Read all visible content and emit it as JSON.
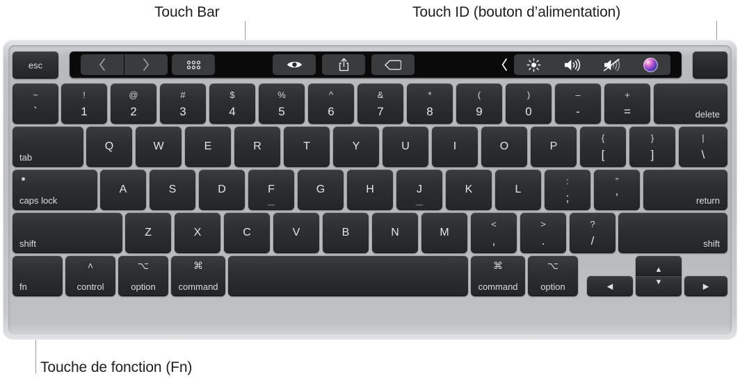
{
  "callouts": [
    {
      "label": "Touch Bar",
      "name": "callout-touch-bar"
    },
    {
      "label": "Touch ID (bouton d’alimentation)",
      "name": "callout-touch-id"
    },
    {
      "label": "Touche de fonction (Fn)",
      "name": "callout-fn"
    }
  ],
  "touchbar": {
    "esc_label": "esc",
    "controls": [
      {
        "name": "back-icon",
        "glyph": "‹"
      },
      {
        "name": "forward-icon",
        "glyph": "›"
      },
      {
        "name": "app-grid-icon",
        "glyph": "grid"
      },
      {
        "name": "preview-eye-icon",
        "glyph": "eye"
      },
      {
        "name": "share-icon",
        "glyph": "share"
      },
      {
        "name": "tag-icon",
        "glyph": "tag"
      },
      {
        "name": "expand-chevron-icon",
        "glyph": "‹"
      },
      {
        "name": "brightness-icon",
        "glyph": "brightness"
      },
      {
        "name": "volume-up-icon",
        "glyph": "volume"
      },
      {
        "name": "mute-icon",
        "glyph": "mute"
      },
      {
        "name": "siri-icon",
        "glyph": "siri"
      }
    ]
  },
  "rows": {
    "number_row": [
      {
        "name": "key-grave",
        "type": "dual",
        "up": "~",
        "down": "`"
      },
      {
        "name": "key-1",
        "type": "dual",
        "up": "!",
        "down": "1"
      },
      {
        "name": "key-2",
        "type": "dual",
        "up": "@",
        "down": "2"
      },
      {
        "name": "key-3",
        "type": "dual",
        "up": "#",
        "down": "3"
      },
      {
        "name": "key-4",
        "type": "dual",
        "up": "$",
        "down": "4"
      },
      {
        "name": "key-5",
        "type": "dual",
        "up": "%",
        "down": "5"
      },
      {
        "name": "key-6",
        "type": "dual",
        "up": "^",
        "down": "6"
      },
      {
        "name": "key-7",
        "type": "dual",
        "up": "&",
        "down": "7"
      },
      {
        "name": "key-8",
        "type": "dual",
        "up": "*",
        "down": "8"
      },
      {
        "name": "key-9",
        "type": "dual",
        "up": "(",
        "down": "9"
      },
      {
        "name": "key-0",
        "type": "dual",
        "up": ")",
        "down": "0"
      },
      {
        "name": "key-minus",
        "type": "dual",
        "up": "–",
        "down": "-"
      },
      {
        "name": "key-equal",
        "type": "dual",
        "up": "+",
        "down": "="
      },
      {
        "name": "key-delete",
        "type": "br",
        "label": "delete"
      }
    ],
    "qwerty_row": [
      {
        "name": "key-tab",
        "type": "bl",
        "label": "tab"
      },
      {
        "name": "key-q",
        "type": "center",
        "label": "Q"
      },
      {
        "name": "key-w",
        "type": "center",
        "label": "W"
      },
      {
        "name": "key-e",
        "type": "center",
        "label": "E"
      },
      {
        "name": "key-r",
        "type": "center",
        "label": "R"
      },
      {
        "name": "key-t",
        "type": "center",
        "label": "T"
      },
      {
        "name": "key-y",
        "type": "center",
        "label": "Y"
      },
      {
        "name": "key-u",
        "type": "center",
        "label": "U"
      },
      {
        "name": "key-i",
        "type": "center",
        "label": "I"
      },
      {
        "name": "key-o",
        "type": "center",
        "label": "O"
      },
      {
        "name": "key-p",
        "type": "center",
        "label": "P"
      },
      {
        "name": "key-bracket-left",
        "type": "dual",
        "up": "{",
        "down": "["
      },
      {
        "name": "key-bracket-right",
        "type": "dual",
        "up": "}",
        "down": "]"
      },
      {
        "name": "key-backslash",
        "type": "dual",
        "up": "|",
        "down": "\\"
      }
    ],
    "home_row": [
      {
        "name": "key-caps-lock",
        "type": "caps",
        "label": "caps lock"
      },
      {
        "name": "key-a",
        "type": "center",
        "label": "A"
      },
      {
        "name": "key-s",
        "type": "center",
        "label": "S"
      },
      {
        "name": "key-d",
        "type": "center",
        "label": "D"
      },
      {
        "name": "key-f",
        "type": "center",
        "label": "F",
        "bump": true
      },
      {
        "name": "key-g",
        "type": "center",
        "label": "G"
      },
      {
        "name": "key-h",
        "type": "center",
        "label": "H"
      },
      {
        "name": "key-j",
        "type": "center",
        "label": "J",
        "bump": true
      },
      {
        "name": "key-k",
        "type": "center",
        "label": "K"
      },
      {
        "name": "key-l",
        "type": "center",
        "label": "L"
      },
      {
        "name": "key-semicolon",
        "type": "dual",
        "up": ":",
        "down": ";"
      },
      {
        "name": "key-quote",
        "type": "dual",
        "up": "”",
        "down": "’"
      },
      {
        "name": "key-return",
        "type": "br",
        "label": "return"
      }
    ],
    "shift_row": [
      {
        "name": "key-shift-left",
        "type": "bl",
        "label": "shift"
      },
      {
        "name": "key-z",
        "type": "center",
        "label": "Z"
      },
      {
        "name": "key-x",
        "type": "center",
        "label": "X"
      },
      {
        "name": "key-c",
        "type": "center",
        "label": "C"
      },
      {
        "name": "key-v",
        "type": "center",
        "label": "V"
      },
      {
        "name": "key-b",
        "type": "center",
        "label": "B"
      },
      {
        "name": "key-n",
        "type": "center",
        "label": "N"
      },
      {
        "name": "key-m",
        "type": "center",
        "label": "M"
      },
      {
        "name": "key-comma",
        "type": "dual",
        "up": "<",
        "down": ","
      },
      {
        "name": "key-period",
        "type": "dual",
        "up": ">",
        "down": "."
      },
      {
        "name": "key-slash",
        "type": "dual",
        "up": "?",
        "down": "/"
      },
      {
        "name": "key-shift-right",
        "type": "br",
        "label": "shift"
      }
    ],
    "bottom_row": [
      {
        "name": "key-fn",
        "type": "bl",
        "label": "fn"
      },
      {
        "name": "key-control",
        "type": "mod",
        "label": "control",
        "symbol": "˄"
      },
      {
        "name": "key-option-left",
        "type": "mod",
        "label": "option",
        "symbol": "⌥"
      },
      {
        "name": "key-command-left",
        "type": "mod",
        "label": "command",
        "symbol": "⌘"
      },
      {
        "name": "key-space",
        "type": "blank",
        "label": ""
      },
      {
        "name": "key-command-right",
        "type": "mod",
        "label": "command",
        "symbol": "⌘"
      },
      {
        "name": "key-option-right",
        "type": "mod",
        "label": "option",
        "symbol": "⌥"
      },
      {
        "name": "key-arrow-left",
        "type": "arrow",
        "label": "◀"
      },
      {
        "name": "key-arrow-up",
        "type": "arrow",
        "label": "▲"
      },
      {
        "name": "key-arrow-down",
        "type": "arrow",
        "label": "▼"
      },
      {
        "name": "key-arrow-right",
        "type": "arrow",
        "label": "▶"
      }
    ]
  },
  "touch_id": {
    "name": "touch-id-button",
    "label": ""
  },
  "colors": {
    "key_face": "#2e2f31",
    "key_text": "#e4e5e6",
    "chassis": "#bfc1c4",
    "touchbar_bg": "#0a0a0b",
    "touchbar_btn": "#3a3b3d",
    "leader_line": "#9a9a9a",
    "caption_text": "#1d1d1f"
  }
}
